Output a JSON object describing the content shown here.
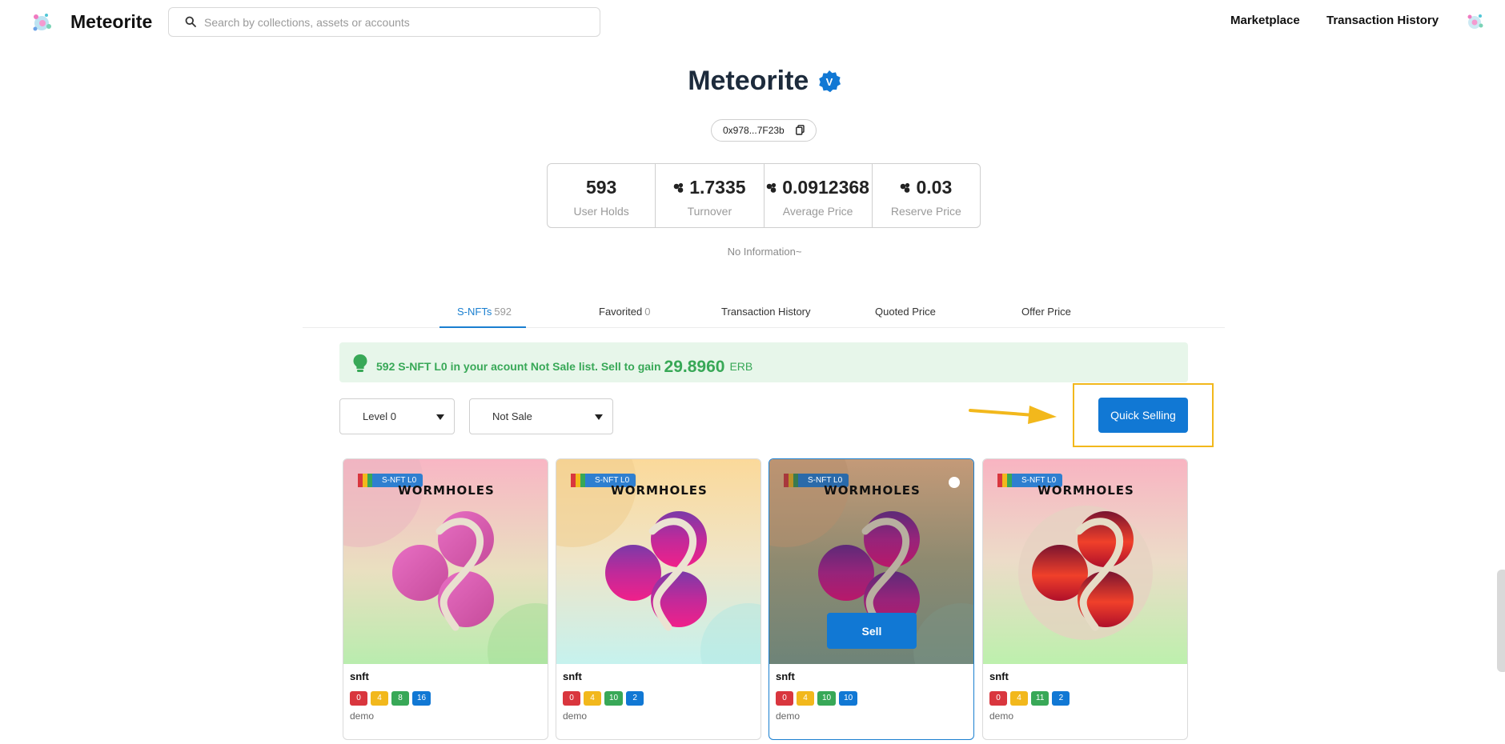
{
  "header": {
    "brand": "Meteorite",
    "search_placeholder": "Search by collections, assets or accounts",
    "nav": [
      "Marketplace",
      "Transaction History"
    ]
  },
  "profile": {
    "title": "Meteorite",
    "verified_mark": "V",
    "address": "0x978...7F23b",
    "no_info": "No Information~",
    "stats": [
      {
        "value": "593",
        "label": "User Holds",
        "icon": ""
      },
      {
        "value": "1.7335",
        "label": "Turnover",
        "icon": "erb-coin-icon"
      },
      {
        "value": "0.0912368",
        "label": "Average Price",
        "icon": "erb-coin-icon"
      },
      {
        "value": "0.03",
        "label": "Reserve Price",
        "icon": "erb-coin-icon"
      }
    ]
  },
  "tabs": [
    {
      "label": "S-NFTs",
      "count": "592",
      "active": true
    },
    {
      "label": "Favorited",
      "count": "0",
      "active": false
    },
    {
      "label": "Transaction History",
      "count": "",
      "active": false
    },
    {
      "label": "Quoted Price",
      "count": "",
      "active": false
    },
    {
      "label": "Offer Price",
      "count": "",
      "active": false
    }
  ],
  "notice": {
    "text": "592 S-NFT L0 in your acount Not Sale list. Sell to gain",
    "gain": "29.8960",
    "unit": "ERB"
  },
  "filters": {
    "level": "Level 0",
    "status": "Not Sale"
  },
  "quick_selling_label": "Quick Selling",
  "colors": {
    "accent": "#1178d4",
    "notice_green": "#38a857",
    "annotation": "#f2b81c",
    "chip_red": "#d9363e",
    "chip_yellow": "#f2b81c",
    "chip_green": "#38a857",
    "chip_blue": "#1178d4"
  },
  "cards": [
    {
      "badge": "S-NFT L0",
      "wordmark": "WORMHOLES",
      "name": "snft",
      "chips": [
        "0",
        "4",
        "8",
        "16"
      ],
      "owner": "demo",
      "selected": false,
      "sell_label": ""
    },
    {
      "badge": "S-NFT L0",
      "wordmark": "WORMHOLES",
      "name": "snft",
      "chips": [
        "0",
        "4",
        "10",
        "2"
      ],
      "owner": "demo",
      "selected": false,
      "sell_label": ""
    },
    {
      "badge": "S-NFT L0",
      "wordmark": "WORMHOLES",
      "name": "snft",
      "chips": [
        "0",
        "4",
        "10",
        "10"
      ],
      "owner": "demo",
      "selected": true,
      "sell_label": "Sell"
    },
    {
      "badge": "S-NFT L0",
      "wordmark": "WORMHOLES",
      "name": "snft",
      "chips": [
        "0",
        "4",
        "11",
        "2"
      ],
      "owner": "demo",
      "selected": false,
      "sell_label": ""
    }
  ]
}
